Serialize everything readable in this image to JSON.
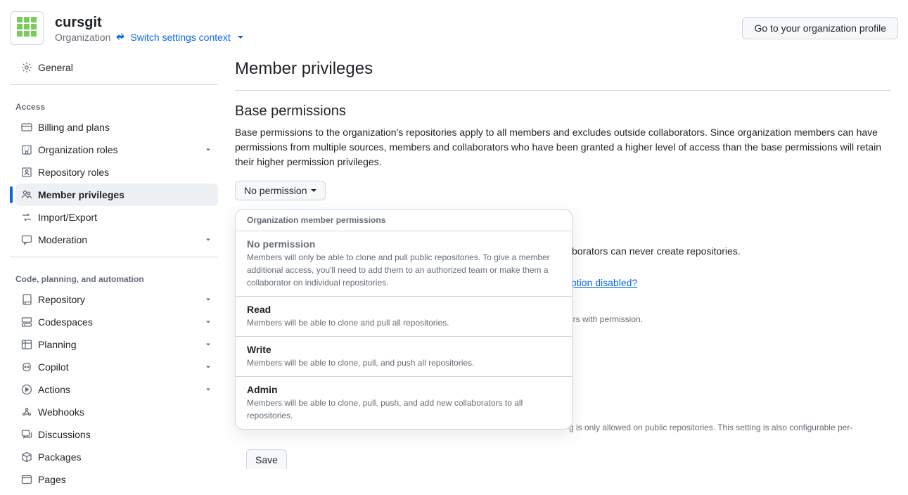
{
  "header": {
    "org_name": "cursgit",
    "org_type": "Organization",
    "switch_label": "Switch settings context",
    "profile_btn": "Go to your organization profile"
  },
  "sidebar": {
    "general": "General",
    "group_access": "Access",
    "billing": "Billing and plans",
    "org_roles": "Organization roles",
    "repo_roles": "Repository roles",
    "member_privileges": "Member privileges",
    "import_export": "Import/Export",
    "moderation": "Moderation",
    "group_code": "Code, planning, and automation",
    "repository": "Repository",
    "codespaces": "Codespaces",
    "planning": "Planning",
    "copilot": "Copilot",
    "actions": "Actions",
    "webhooks": "Webhooks",
    "discussions": "Discussions",
    "packages": "Packages",
    "pages": "Pages"
  },
  "main": {
    "title": "Member privileges",
    "base_title": "Base permissions",
    "base_desc": "Base permissions to the organization's repositories apply to all members and excludes outside collaborators. Since organization members can have permissions from multiple sources, members and collaborators who have been granted a higher level of access than the base permissions will retain their higher permission privileges.",
    "dropdown_selected": "No permission",
    "dropdown_header": "Organization member permissions",
    "options": [
      {
        "title": "No permission",
        "desc": "Members will only be able to clone and pull public repositories. To give a member additional access, you'll need to add them to an authorized team or make them a collaborator on individual repositories."
      },
      {
        "title": "Read",
        "desc": "Members will be able to clone and pull all repositories."
      },
      {
        "title": "Write",
        "desc": "Members will be able to clone, pull, and push all repositories."
      },
      {
        "title": "Admin",
        "desc": "Members will be able to clone, pull, push, and add new collaborators to all repositories."
      }
    ],
    "bg_collab_tail": "llaborators can never create repositories.",
    "bg_option_link": "ption disabled?",
    "bg_permission_tail": "ers with permission.",
    "bg_forking_tail": "g is only allowed on public repositories. This setting is also configurable per-",
    "save_label": "Save"
  }
}
